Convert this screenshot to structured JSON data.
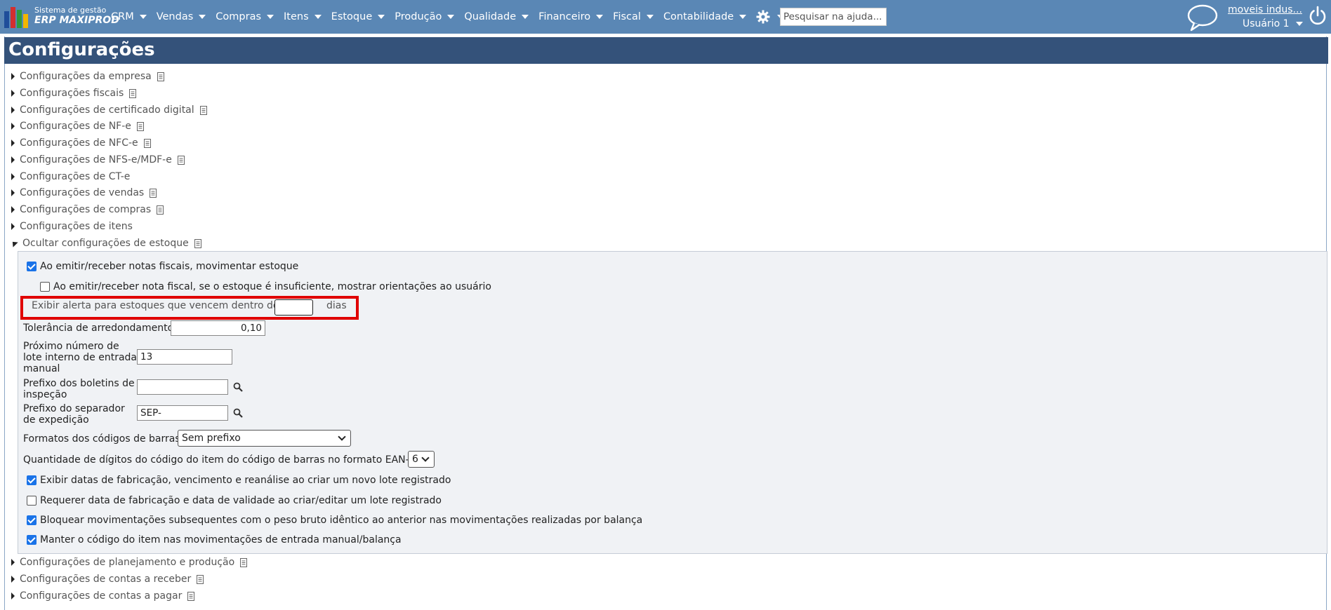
{
  "header": {
    "logo_line1": "Sistema de gestão",
    "logo_line2": "ERP MAXIPROD",
    "menu": [
      "CRM",
      "Vendas",
      "Compras",
      "Itens",
      "Estoque",
      "Produção",
      "Qualidade",
      "Financeiro",
      "Fiscal",
      "Contabilidade"
    ],
    "search_placeholder": "Pesquisar na ajuda...",
    "company": "moveis indus...",
    "user": "Usuário 1",
    "icons": [
      "gear-icon",
      "help-icon",
      "chat-icon",
      "power-icon"
    ]
  },
  "page": {
    "title": "Configurações"
  },
  "sections_top": [
    "Configurações da empresa",
    "Configurações fiscais",
    "Configurações de certificado digital",
    "Configurações de NF-e",
    "Configurações de NFC-e",
    "Configurações de NFS-e/MDF-e",
    "Configurações de CT-e",
    "Configurações de vendas",
    "Configurações de compras",
    "Configurações de itens"
  ],
  "stock_section": {
    "toggle_label": "Ocultar configurações de estoque",
    "move_stock_on_invoice": {
      "label": "Ao emitir/receber notas fiscais, movimentar estoque",
      "checked": true
    },
    "show_guidance_insufficient": {
      "label": "Ao emitir/receber nota fiscal, se o estoque é insuficiente, mostrar orientações ao usuário",
      "checked": false
    },
    "expiry_alert": {
      "label": "Exibir alerta para estoques que vencem dentro de",
      "value": "",
      "suffix": "dias"
    },
    "rounding_tolerance": {
      "label": "Tolerância de arredondamento",
      "value": "0,10"
    },
    "next_lot_number": {
      "label_lines": [
        "Próximo número de",
        "lote interno de entrada",
        "manual"
      ],
      "value": "13"
    },
    "inspection_prefix": {
      "label_lines": [
        "Prefixo dos boletins de",
        "inspeção"
      ],
      "value": ""
    },
    "shipping_prefix": {
      "label_lines": [
        "Prefixo do separador",
        "de expedição"
      ],
      "value": "SEP-"
    },
    "barcode_format": {
      "label": "Formatos dos códigos de barras",
      "selected": "Sem prefixo"
    },
    "ean13_digits": {
      "label": "Quantidade de dígitos do código do item do código de barras no formato EAN-13",
      "selected": "6"
    },
    "show_dates_new_lot": {
      "label": "Exibir datas de fabricação, vencimento e reanálise ao criar um novo lote registrado",
      "checked": true
    },
    "require_dates_lot": {
      "label": "Requerer data de fabricação e data de validade ao criar/editar um lote registrado",
      "checked": false
    },
    "block_same_weight": {
      "label": "Bloquear movimentações subsequentes com o peso bruto idêntico ao anterior nas movimentações realizadas por balança",
      "checked": true
    },
    "keep_item_code": {
      "label": "Manter o código do item nas movimentações de entrada manual/balança",
      "checked": true
    }
  },
  "sections_bottom": [
    "Configurações de planejamento e produção",
    "Configurações de contas a receber",
    "Configurações de contas a pagar"
  ],
  "colors": {
    "topbar": "#5a87b5",
    "titlebar": "#34527a",
    "highlight": "#e00000",
    "checkbox": "#1a73e8"
  }
}
